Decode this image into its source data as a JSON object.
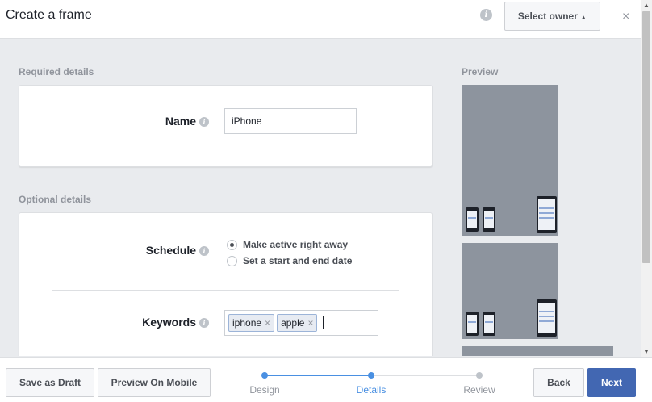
{
  "header": {
    "title": "Create a frame",
    "owner_button": "Select owner",
    "close": "×"
  },
  "required": {
    "section_label": "Required details",
    "name_label": "Name",
    "name_value": "iPhone"
  },
  "optional": {
    "section_label": "Optional details",
    "schedule_label": "Schedule",
    "schedule_options": [
      {
        "label": "Make active right away",
        "checked": true
      },
      {
        "label": "Set a start and end date",
        "checked": false
      }
    ],
    "keywords_label": "Keywords",
    "keywords": [
      "iphone",
      "apple"
    ]
  },
  "preview": {
    "label": "Preview"
  },
  "footer": {
    "save_draft": "Save as Draft",
    "preview_mobile": "Preview On Mobile",
    "steps": [
      {
        "label": "Design",
        "state": "done"
      },
      {
        "label": "Details",
        "state": "active"
      },
      {
        "label": "Review",
        "state": "todo"
      }
    ],
    "back": "Back",
    "next": "Next"
  },
  "colors": {
    "accent": "#4267b2",
    "step_active": "#4a90e2",
    "step_inactive": "#bec3c9"
  }
}
